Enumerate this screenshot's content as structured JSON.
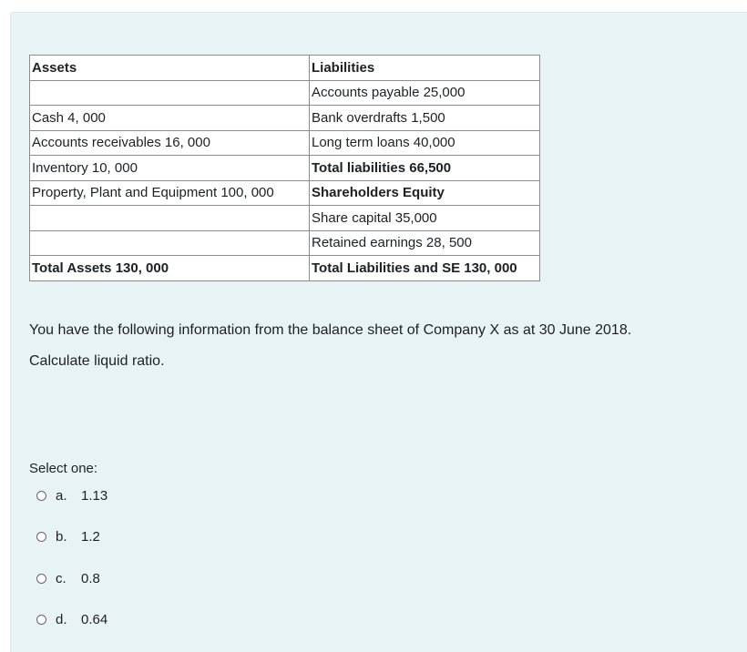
{
  "table": {
    "rows": [
      {
        "assets": "Assets",
        "liabilities": "Liabilities",
        "assets_bold": true,
        "liab_bold": true
      },
      {
        "assets": "",
        "liabilities": "Accounts payable 25,000",
        "assets_bold": false,
        "liab_bold": false
      },
      {
        "assets": "Cash 4, 000",
        "liabilities": "Bank overdrafts 1,500",
        "assets_bold": false,
        "liab_bold": false
      },
      {
        "assets": "Accounts receivables 16, 000",
        "liabilities": "Long term loans 40,000",
        "assets_bold": false,
        "liab_bold": false
      },
      {
        "assets": "Inventory 10, 000",
        "liabilities": "Total liabilities 66,500",
        "assets_bold": false,
        "liab_bold": true
      },
      {
        "assets": "Property, Plant and Equipment 100, 000",
        "liabilities": "Shareholders Equity",
        "assets_bold": false,
        "liab_bold": true
      },
      {
        "assets": "",
        "liabilities": "Share capital 35,000",
        "assets_bold": false,
        "liab_bold": false
      },
      {
        "assets": "",
        "liabilities": "Retained earnings 28, 500",
        "assets_bold": false,
        "liab_bold": false
      },
      {
        "assets": "Total Assets 130, 000",
        "liabilities": "Total Liabilities and SE 130, 000",
        "assets_bold": true,
        "liab_bold": true
      }
    ]
  },
  "question": {
    "text_1": "You have the following information from the balance sheet of Company X as at 30 June 2018.",
    "text_2": "Calculate liquid ratio."
  },
  "answer": {
    "prompt": "Select one:",
    "options": [
      {
        "letter": "a.",
        "value": "1.13"
      },
      {
        "letter": "b.",
        "value": "1.2"
      },
      {
        "letter": "c.",
        "value": "0.8"
      },
      {
        "letter": "d.",
        "value": "0.64"
      }
    ]
  }
}
